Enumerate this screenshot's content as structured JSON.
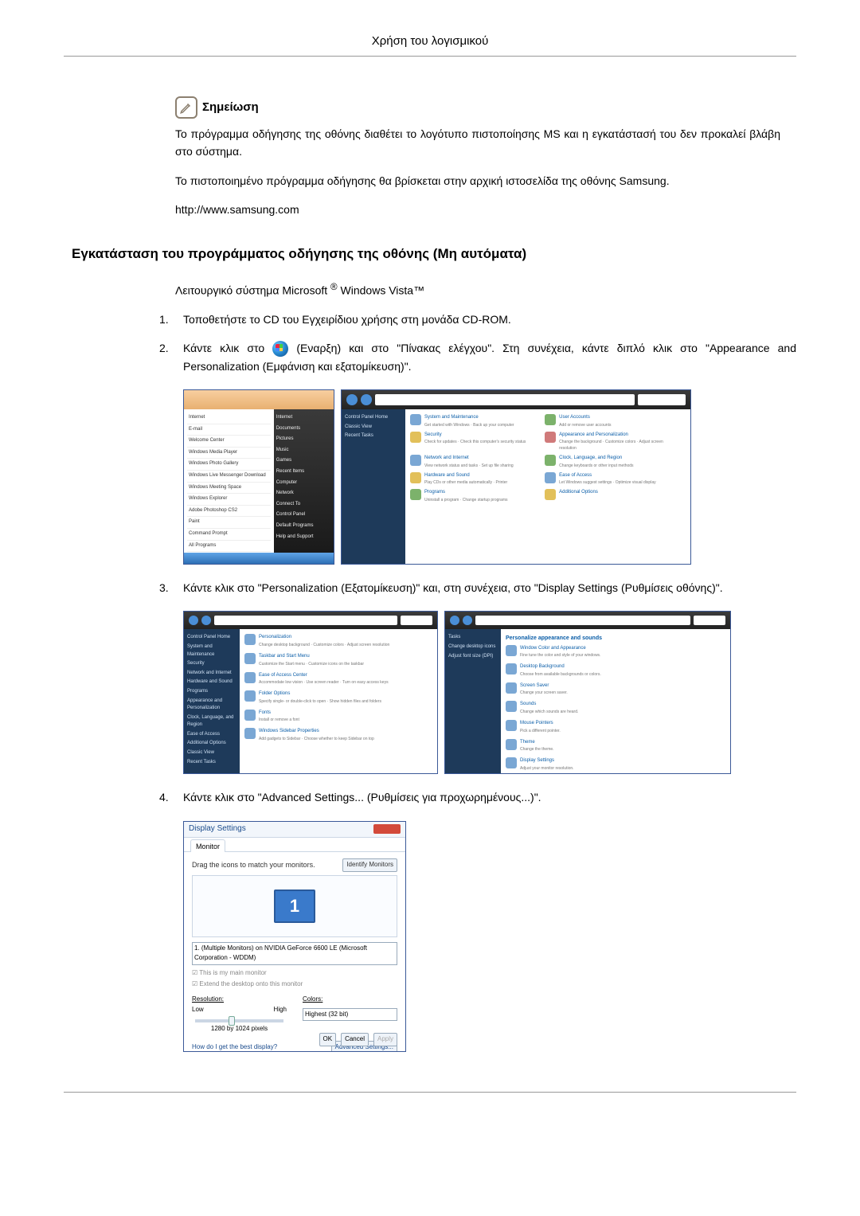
{
  "header": {
    "title": "Χρήση του λογισμικού"
  },
  "note": {
    "label": "Σημείωση",
    "p1": "Το πρόγραμμα οδήγησης της οθόνης διαθέτει το λογότυπο πιστοποίησης MS και η εγκατάστασή του δεν προκαλεί βλάβη στο σύστημα.",
    "p2": "Το πιστοποιημένο πρόγραμμα οδήγησης θα βρίσκεται στην αρχική ιστοσελίδα της οθόνης Samsung.",
    "url": "http://www.samsung.com"
  },
  "section": {
    "title": "Εγκατάσταση του προγράμματος οδήγησης της οθόνης (Μη αυτόματα)"
  },
  "os_line": {
    "pre": "Λειτουργικό σύστημα Microsoft ",
    "reg": "®",
    "post": " Windows Vista™"
  },
  "steps": {
    "s1": {
      "num": "1.",
      "text": "Τοποθετήστε το CD του Εγχειρίδιου χρήσης στη μονάδα CD-ROM."
    },
    "s2": {
      "num": "2.",
      "pre": "Κάντε κλικ στο ",
      "post": " (Εναρξη) και στο \"Πίνακας ελέγχου\". Στη συνέχεια, κάντε διπλό κλικ στο \"Appearance and Personalization (Εμφάνιση και εξατομίκευση)\"."
    },
    "s3": {
      "num": "3.",
      "text": "Κάντε κλικ στο \"Personalization (Εξατομίκευση)\" και, στη συνέχεια, στο \"Display Settings (Ρυθμίσεις οθόνης)\"."
    },
    "s4": {
      "num": "4.",
      "text": "Κάντε κλικ στο \"Advanced Settings... (Ρυθμίσεις για προχωρημένους...)\"."
    }
  },
  "start_menu": {
    "left": [
      "Internet",
      "E-mail",
      "Welcome Center",
      "Windows Media Player",
      "Windows Photo Gallery",
      "Windows Live Messenger Download",
      "Windows Meeting Space",
      "Windows Explorer",
      "Adobe Photoshop CS2",
      "Paint",
      "Command Prompt",
      "All Programs"
    ],
    "right": [
      "Internet",
      "Documents",
      "Pictures",
      "Music",
      "Games",
      "Recent Items",
      "Computer",
      "Network",
      "Connect To",
      "Control Panel",
      "Default Programs",
      "Help and Support"
    ]
  },
  "control_panel": {
    "side": [
      "Control Panel Home",
      "Classic View",
      "Recent Tasks"
    ],
    "items": [
      {
        "t": "System and Maintenance",
        "s": "Get started with Windows · Back up your computer"
      },
      {
        "t": "User Accounts",
        "s": "Add or remove user accounts"
      },
      {
        "t": "Security",
        "s": "Check for updates · Check this computer's security status"
      },
      {
        "t": "Appearance and Personalization",
        "s": "Change the background · Customize colors · Adjust screen resolution"
      },
      {
        "t": "Network and Internet",
        "s": "View network status and tasks · Set up file sharing"
      },
      {
        "t": "Clock, Language, and Region",
        "s": "Change keyboards or other input methods"
      },
      {
        "t": "Hardware and Sound",
        "s": "Play CDs or other media automatically · Printer"
      },
      {
        "t": "Ease of Access",
        "s": "Let Windows suggest settings · Optimize visual display"
      },
      {
        "t": "Programs",
        "s": "Uninstall a program · Change startup programs"
      },
      {
        "t": "Additional Options",
        "s": ""
      }
    ]
  },
  "personalization_left": {
    "side": [
      "Control Panel Home",
      "System and Maintenance",
      "Security",
      "Network and Internet",
      "Hardware and Sound",
      "Programs",
      "Appearance and Personalization",
      "Clock, Language, and Region",
      "Ease of Access",
      "Additional Options",
      "Classic View",
      "Recent Tasks"
    ],
    "items": [
      {
        "t": "Personalization",
        "s": "Change desktop background · Customize colors · Adjust screen resolution"
      },
      {
        "t": "Taskbar and Start Menu",
        "s": "Customize the Start menu · Customize icons on the taskbar"
      },
      {
        "t": "Ease of Access Center",
        "s": "Accommodate low vision · Use screen reader · Turn on easy access keys"
      },
      {
        "t": "Folder Options",
        "s": "Specify single- or double-click to open · Show hidden files and folders"
      },
      {
        "t": "Fonts",
        "s": "Install or remove a font"
      },
      {
        "t": "Windows Sidebar Properties",
        "s": "Add gadgets to Sidebar · Choose whether to keep Sidebar on top"
      }
    ]
  },
  "personalization_right": {
    "side": [
      "Tasks",
      "Change desktop icons",
      "Adjust font size (DPI)"
    ],
    "heading": "Personalize appearance and sounds",
    "items": [
      {
        "t": "Window Color and Appearance",
        "s": "Fine tune the color and style of your windows."
      },
      {
        "t": "Desktop Background",
        "s": "Choose from available backgrounds or colors."
      },
      {
        "t": "Screen Saver",
        "s": "Change your screen saver."
      },
      {
        "t": "Sounds",
        "s": "Change which sounds are heard."
      },
      {
        "t": "Mouse Pointers",
        "s": "Pick a different pointer."
      },
      {
        "t": "Theme",
        "s": "Change the theme."
      },
      {
        "t": "Display Settings",
        "s": "Adjust your monitor resolution."
      }
    ]
  },
  "display_settings": {
    "title": "Display Settings",
    "tab": "Monitor",
    "drag": "Drag the icons to match your monitors.",
    "identify": "Identify Monitors",
    "monitor_num": "1",
    "combo": "1. (Multiple Monitors) on NVIDIA GeForce 6600 LE (Microsoft Corporation - WDDM)",
    "chk_main": "This is my main monitor",
    "chk_extend": "Extend the desktop onto this monitor",
    "res_label": "Resolution:",
    "low": "Low",
    "high": "High",
    "res_value": "1280 by 1024 pixels",
    "color_label": "Colors:",
    "color_value": "Highest (32 bit)",
    "help_link": "How do I get the best display?",
    "adv": "Advanced Settings...",
    "ok": "OK",
    "cancel": "Cancel",
    "apply": "Apply"
  }
}
